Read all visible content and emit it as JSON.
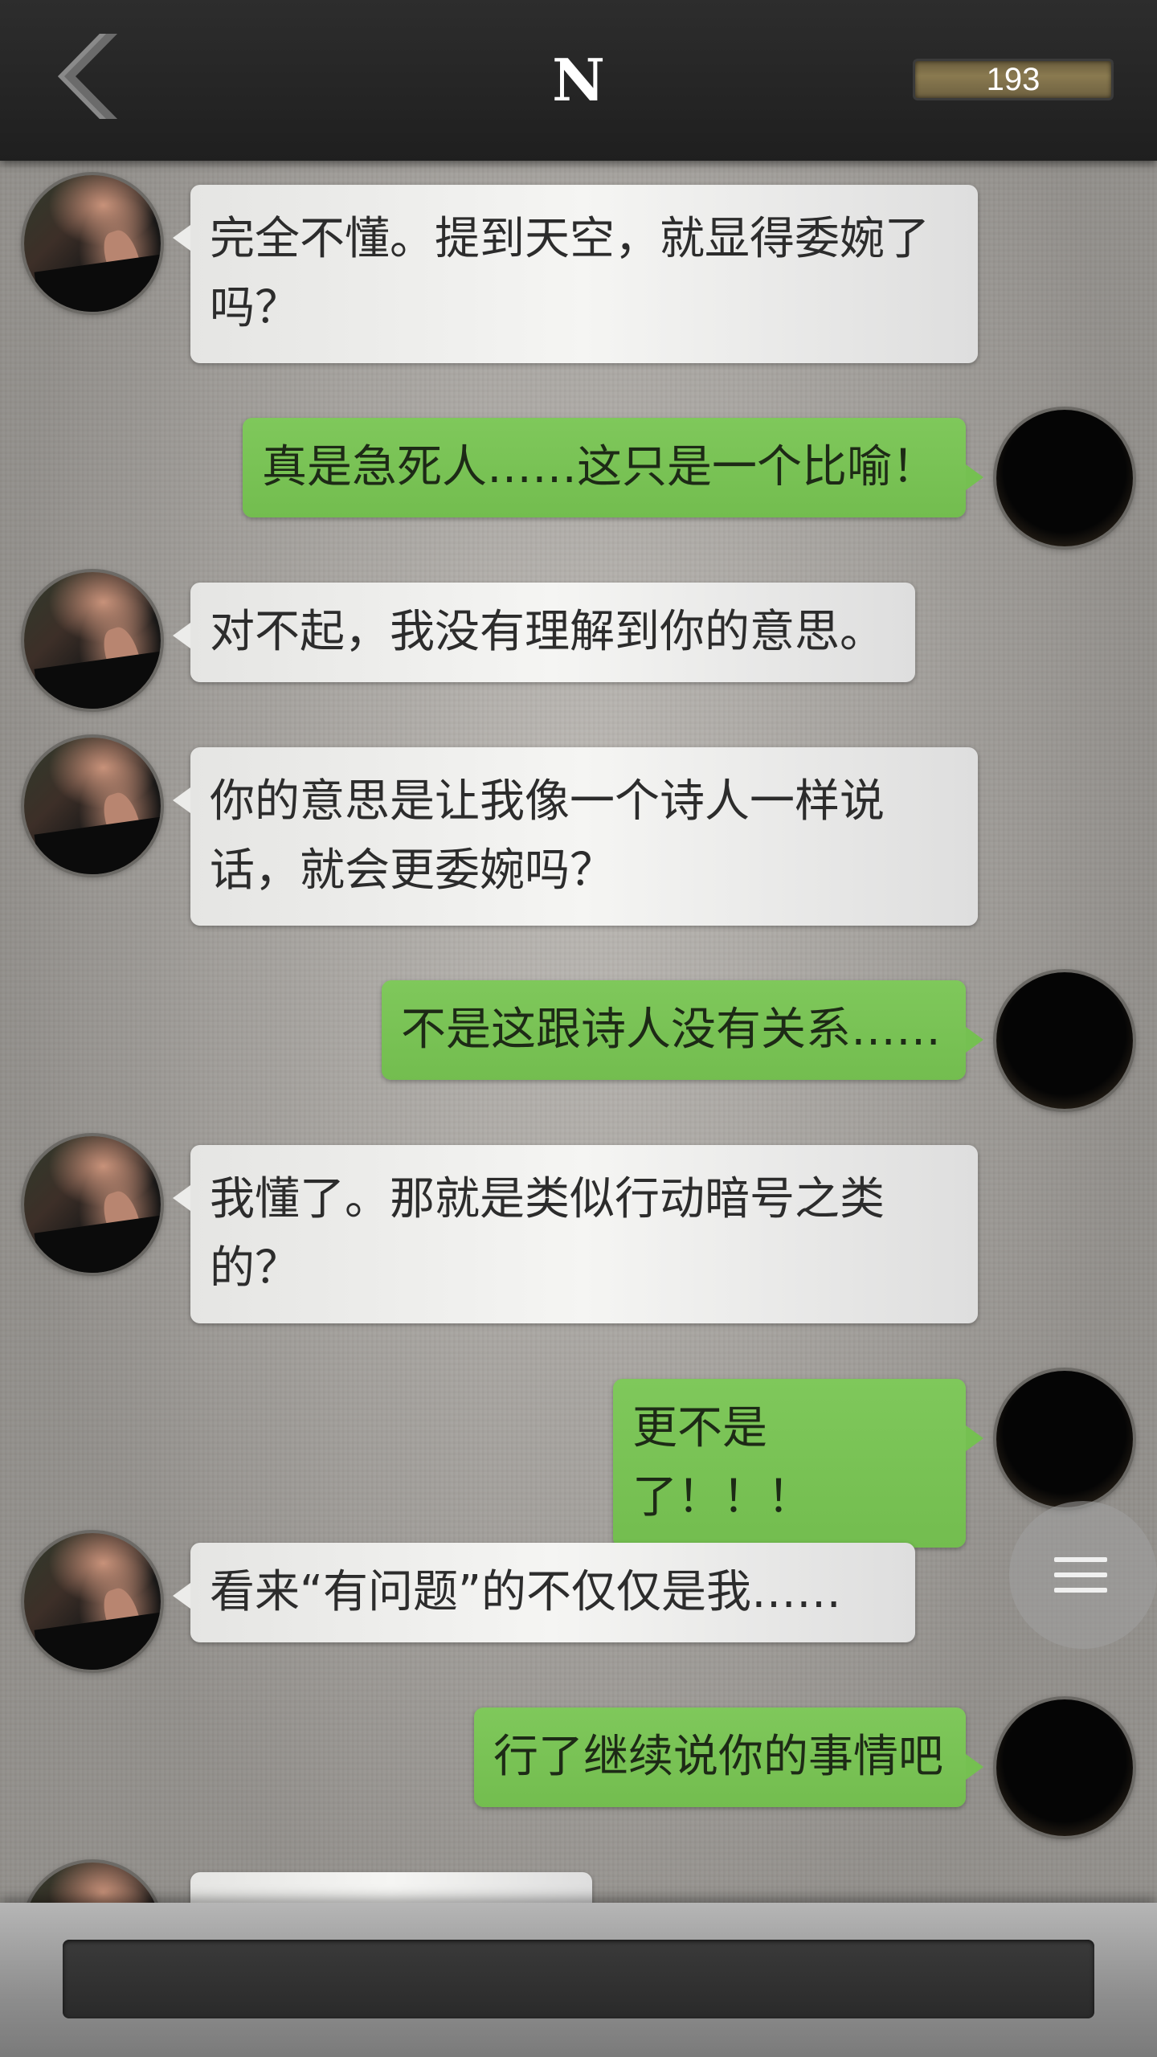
{
  "header": {
    "title": "N",
    "counter": "193",
    "back_icon": "chevron-left-icon"
  },
  "messages": [
    {
      "sender": "other",
      "text": "完全不懂。提到天空，就显得委婉了吗？"
    },
    {
      "sender": "self",
      "text": "真是急死人……这只是一个比喻！"
    },
    {
      "sender": "other",
      "text": "对不起，我没有理解到你的意思。"
    },
    {
      "sender": "other",
      "text": "你的意思是让我像一个诗人一样说话，就会更委婉吗？"
    },
    {
      "sender": "self",
      "text": "不是这跟诗人没有关系……"
    },
    {
      "sender": "other",
      "text": "我懂了。那就是类似行动暗号之类的？"
    },
    {
      "sender": "self",
      "text": "更不是了！！！"
    },
    {
      "sender": "other",
      "text": "看来“有问题”的不仅仅是我……"
    },
    {
      "sender": "self",
      "text": "行了继续说你的事情吧"
    },
    {
      "sender": "other",
      "text": ""
    }
  ],
  "menu": {
    "icon": "menu-icon"
  },
  "input": {
    "value": "",
    "placeholder": ""
  },
  "colors": {
    "self_bubble": "#7fc85b",
    "other_bubble": "#f0f0ee",
    "header_bg": "#262626",
    "counter_bg": "#8a7a50"
  }
}
